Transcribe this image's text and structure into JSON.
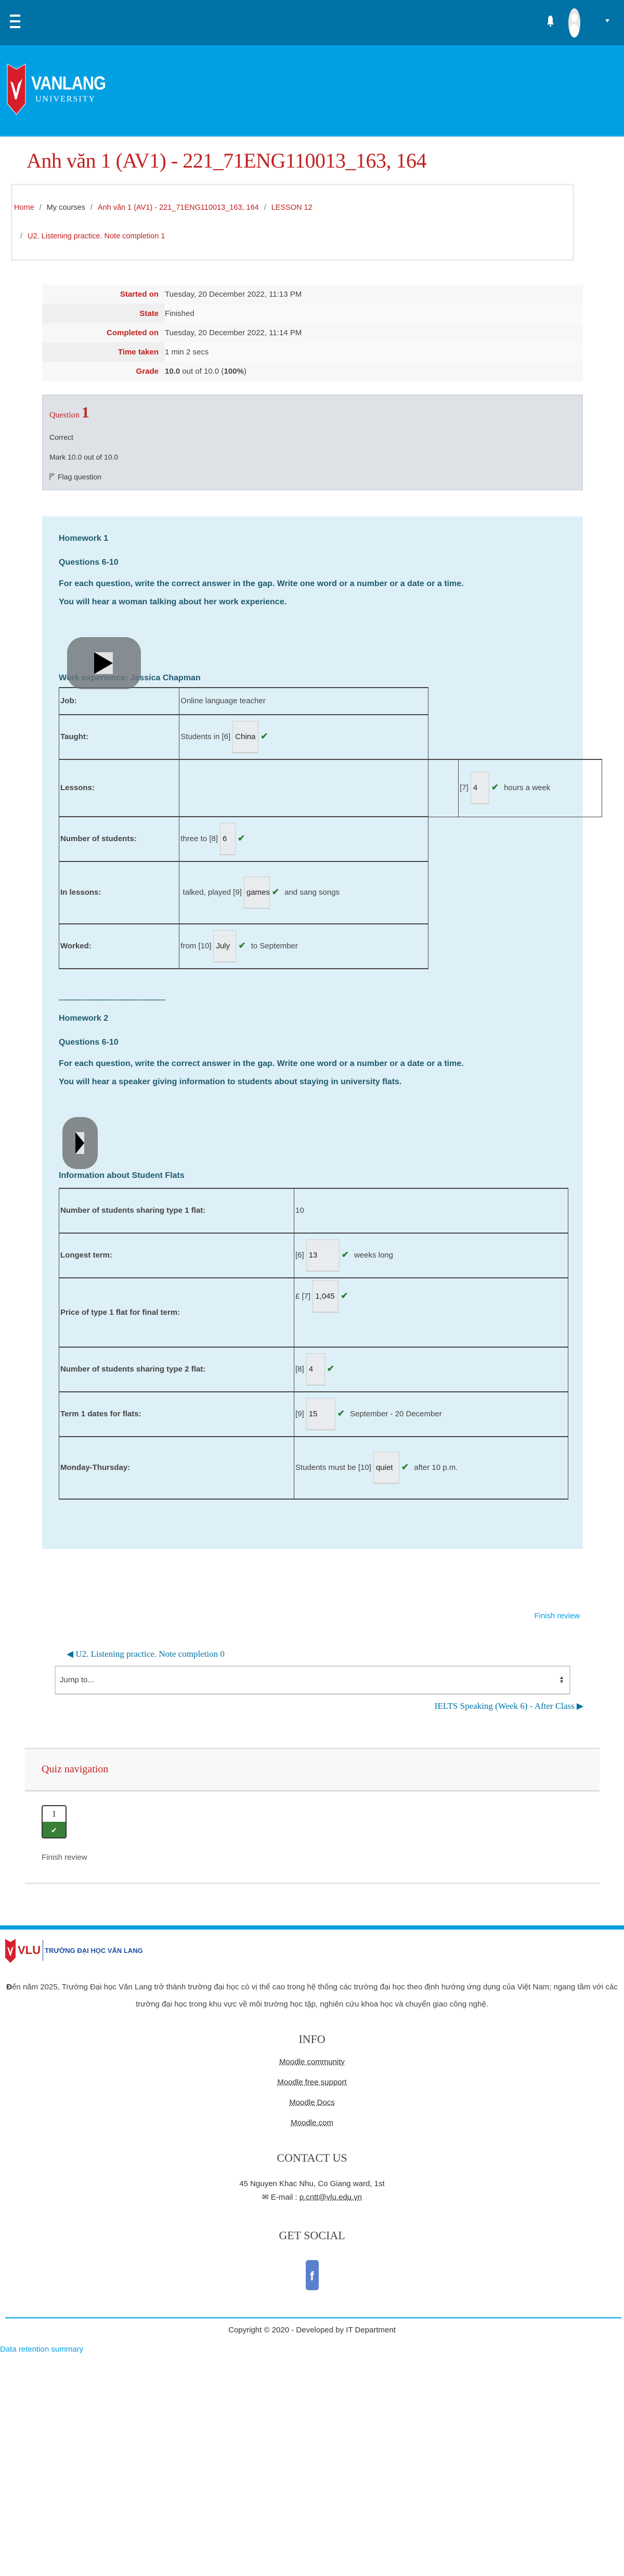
{
  "header": {
    "menu_icon": "hamburger-icon",
    "notification_icon": "bell-icon",
    "user_icon": "user-avatar",
    "logo_main": "VANLANG",
    "logo_sub": "UNIVERSITY"
  },
  "page": {
    "title": "Anh văn 1 (AV1) - 221_71ENG110013_163, 164"
  },
  "breadcrumb": [
    {
      "label": "Home",
      "link": true
    },
    {
      "label": "My courses",
      "link": false
    },
    {
      "label": "Anh văn 1 (AV1) - 221_71ENG110013_163, 164",
      "link": true
    },
    {
      "label": "LESSON 12",
      "link": true
    },
    {
      "label": "U2. Listening practice. Note completion 1",
      "link": true
    }
  ],
  "summary": [
    {
      "label": "Started on",
      "value": "Tuesday, 20 December 2022, 11:13 PM"
    },
    {
      "label": "State",
      "value": "Finished"
    },
    {
      "label": "Completed on",
      "value": "Tuesday, 20 December 2022, 11:14 PM"
    },
    {
      "label": "Time taken",
      "value": "1 min 2 secs"
    },
    {
      "label": "Grade",
      "value_bold": "10.0",
      "value_mid": " out of 10.0 (",
      "value_pct": "100%",
      "value_end": ")"
    }
  ],
  "question_info": {
    "label": "Question",
    "number": "1",
    "status": "Correct",
    "mark": "Mark 10.0 out of 10.0",
    "flag": "Flag question"
  },
  "homework1": {
    "title": "Homework 1",
    "questions": "Questions 6-10",
    "instruction": "For each question, write the correct answer in the gap. Write one word or a number or a date or a time.",
    "context": "You will hear a woman talking about her work experience.",
    "table_title": "Work experience: Jessica Chapman",
    "rows": {
      "job": {
        "label": "Job:",
        "text": "Online language teacher"
      },
      "taught": {
        "label": "Taught:",
        "before": "Students in [6]",
        "answer": "China"
      },
      "lessons": {
        "label": "Lessons:",
        "before": "[7]",
        "answer": "4",
        "after": "hours a week"
      },
      "students": {
        "label": "Number of students:",
        "before": "three to [8]",
        "answer": "6"
      },
      "inlessons": {
        "label": "In lessons:",
        "before": "talked, played [9]",
        "answer": "games",
        "after": "and sang songs"
      },
      "worked": {
        "label": "Worked:",
        "before": "from [10]",
        "answer": "July",
        "after": "to September"
      }
    }
  },
  "separator": "--------------------------------------------",
  "homework2": {
    "title": "Homework 2",
    "questions": "Questions 6-10",
    "instruction": "For each question, write the correct answer in the gap. Write one word or a number or a date or a time.",
    "context": "You will hear a speaker giving information to students about staying in university flats.",
    "table_title": "Information about Student Flats",
    "rows": {
      "type1": {
        "label": "Number of students sharing type 1 flat:",
        "text": "10"
      },
      "longest": {
        "label": "Longest term:",
        "before": "[6]",
        "answer": "13",
        "after": "weeks long"
      },
      "price": {
        "label": "Price of type 1 flat for final term:",
        "before": "£ [7]",
        "answer": "1,045"
      },
      "type2": {
        "label": "Number of students sharing type 2 flat:",
        "before": "[8]",
        "answer": "4"
      },
      "term1": {
        "label": "Term 1 dates for flats:",
        "before": "[9]",
        "answer": "15",
        "after": "September - 20 December"
      },
      "monthu": {
        "label": "Monday-Thursday:",
        "before": "Students must be [10]",
        "answer": "quiet",
        "after": "after 10 p.m."
      }
    }
  },
  "correct_mark": "✔",
  "navigation": {
    "finish_review": "Finish review",
    "prev_activity": "U2. Listening practice. Note completion 0",
    "jump_to": "Jump to...",
    "next_activity": "IELTS Speaking (Week 6) - After Class"
  },
  "quiz_nav": {
    "title": "Quiz navigation",
    "buttons": [
      {
        "number": "1",
        "state": "correct"
      }
    ],
    "finish": "Finish review"
  },
  "footer": {
    "logo_short": "VLU",
    "logo_full": "TRƯỜNG ĐẠI HỌC VĂN LANG",
    "mission_first": "Đ",
    "mission_rest": "ến năm 2025, Trường Đại học Văn Lang trở thành trường đại học có vị thế cao trong hệ thống các trường đại học theo định hướng ứng dụng của Việt Nam; ngang tầm với các trường đại học trong khu vực về môi trường học tập, nghiên cứu khoa học và chuyển giao công nghệ.",
    "info_title": "INFO",
    "info_links": [
      "Moodle community",
      "Moodle free support",
      "Moodle Docs",
      "Moodle.com"
    ],
    "contact_title": "CONTACT US",
    "address": "45 Nguyen Khac Nhu, Co Giang ward, 1st",
    "email_label": "E-mail : ",
    "email": "p.cntt@vlu.edu.vn",
    "social_title": "GET SOCIAL",
    "social_icon": "facebook-icon",
    "copyright": "Copyright © 2020 - Developed by IT Department",
    "data_retention": "Data retention summary"
  },
  "colors": {
    "navbar": "#0072a5",
    "banner": "#00a0e3",
    "brand_red": "#c1201f",
    "content_bg": "#def0f7",
    "correct_green": "#2e7d32"
  }
}
